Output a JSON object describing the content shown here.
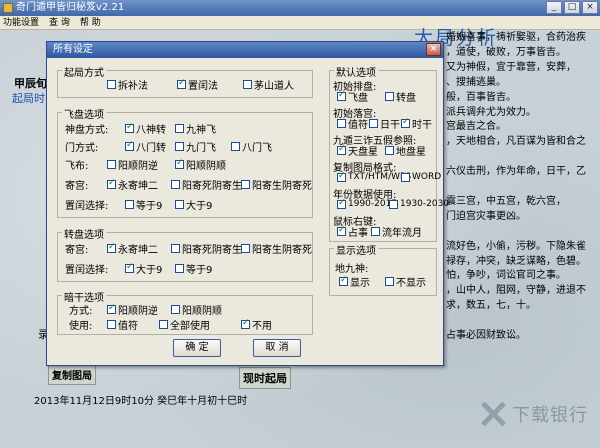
{
  "window": {
    "title": "奇门遁甲皆归秘笈v2.21",
    "minimize": "_",
    "maximize": "□",
    "close": "×"
  },
  "menu": [
    "功能设置",
    "查 询",
    "帮 助"
  ],
  "background": {
    "left_line1": "甲辰旬",
    "left_line2": "起局时间",
    "title": "大局分析",
    "lines": [
      "婚姻喜事，祷祈娶驱，合药治疾",
      "，道使，破败，万事皆吉。",
      "又为神假，宜于靠营，安葬，",
      "、搜捕逃巢。",
      "般，百事皆吉。",
      "派兵调弁尤为效力。",
      "宫最吉之合。",
      "，天地相合，凡百谋为皆和合之",
      "",
      "六仪击刑，作为年命，日干，乙",
      "",
      "震三宫，中五宫，乾六宫，",
      "门迫宫灾事更凶。",
      "",
      "流好色，小偷，污秽。下隐朱雀",
      "禄存，冲突，缺乏谋略，色碧。",
      "怕，争吵，词讼官司之事。",
      "，山中人，阻网，守静，进退不",
      "求，数五，七，十。",
      "",
      "占事必因财致讼。"
    ],
    "left_mid": "录",
    "copy_button": "复制图局",
    "current_button": "现时起局",
    "date_line": "2013年11月12日9时10分  癸巳年十月初十巳时",
    "watermark": "下载银行"
  },
  "dialog": {
    "title": "所有设定",
    "close": "×",
    "qiju": {
      "title": "起局方式",
      "options": [
        {
          "label": "拆补法",
          "checked": false
        },
        {
          "label": "置闰法",
          "checked": true
        },
        {
          "label": "茅山道人",
          "checked": false
        }
      ]
    },
    "feipan": {
      "title": "飞盘选项",
      "rows": [
        {
          "label": "神盘方式:",
          "options": [
            {
              "label": "八神转",
              "checked": true
            },
            {
              "label": "九神飞",
              "checked": false
            }
          ]
        },
        {
          "label": "门方式:",
          "options": [
            {
              "label": "八门转",
              "checked": true
            },
            {
              "label": "九门飞",
              "checked": false
            },
            {
              "label": "八门飞",
              "checked": false
            }
          ]
        },
        {
          "label": "飞布:",
          "options": [
            {
              "label": "阳顺阴逆",
              "checked": false
            },
            {
              "label": "阳顺阴顺",
              "checked": true
            }
          ]
        },
        {
          "label": "寄宫:",
          "options": [
            {
              "label": "永寄坤二",
              "checked": true
            },
            {
              "label": "阳寄死阴寄生",
              "checked": false
            },
            {
              "label": "阳寄生阴寄死",
              "checked": false
            }
          ]
        },
        {
          "label": "置闰选择:",
          "options": [
            {
              "label": "等于9",
              "checked": false
            },
            {
              "label": "大于9",
              "checked": false
            }
          ]
        }
      ]
    },
    "zhuanpan": {
      "title": "转盘选项",
      "rows": [
        {
          "label": "寄宫:",
          "options": [
            {
              "label": "永寄坤二",
              "checked": true
            },
            {
              "label": "阳寄死阴寄生",
              "checked": false
            },
            {
              "label": "阳寄生阴寄死",
              "checked": false
            }
          ]
        },
        {
          "label": "置闰选择:",
          "options": [
            {
              "label": "大于9",
              "checked": true
            },
            {
              "label": "等于9",
              "checked": false
            }
          ]
        }
      ]
    },
    "angan": {
      "title": "暗干选项",
      "rows": [
        {
          "label": "方式:",
          "options": [
            {
              "label": "阳顺阴逆",
              "checked": true
            },
            {
              "label": "阳顺阴顺",
              "checked": false
            }
          ]
        },
        {
          "label": "使用:",
          "options": [
            {
              "label": "值符",
              "checked": false
            },
            {
              "label": "全部使用",
              "checked": false
            },
            {
              "label": "不用",
              "checked": true
            }
          ]
        }
      ]
    },
    "default": {
      "title": "默认选项",
      "init_pan": {
        "label": "初始排盘:",
        "options": [
          {
            "label": "飞盘",
            "checked": true
          },
          {
            "label": "转盘",
            "checked": false
          }
        ]
      },
      "init_fu": {
        "label": "初始落宫:",
        "options": [
          {
            "label": "值符",
            "checked": false
          },
          {
            "label": "日干",
            "checked": false
          },
          {
            "label": "时干",
            "checked": true
          }
        ]
      },
      "jiudun": {
        "label": "九遁三诈五假参照:",
        "options": [
          {
            "label": "天盘星",
            "checked": true
          },
          {
            "label": "地盘星",
            "checked": false
          }
        ]
      },
      "copy_fmt": {
        "label": "复制图局格式:",
        "options": [
          {
            "label": "TXT/HTM/WPS",
            "checked": true
          },
          {
            "label": "WORD",
            "checked": false
          }
        ]
      },
      "year_range": {
        "label": "年份数据使用:",
        "options": [
          {
            "label": "1990-2015",
            "checked": true
          },
          {
            "label": "1930-2030",
            "checked": false
          }
        ]
      },
      "mouse": {
        "label": "鼠标右键:",
        "options": [
          {
            "label": "占事",
            "checked": true
          },
          {
            "label": "流年流月",
            "checked": false
          }
        ]
      }
    },
    "display": {
      "title": "显示选项",
      "dijiu": {
        "label": "地九神:",
        "options": [
          {
            "label": "显示",
            "checked": true
          },
          {
            "label": "不显示",
            "checked": false
          }
        ]
      }
    },
    "ok": "确 定",
    "cancel": "取 消"
  }
}
